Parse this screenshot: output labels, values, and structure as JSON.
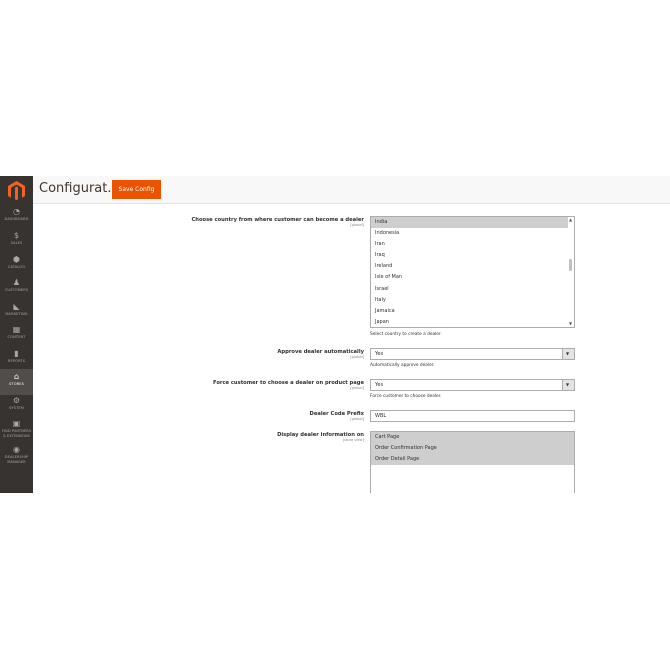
{
  "header": {
    "title": "Configurat...",
    "save_label": "Save Config"
  },
  "sidebar": {
    "items": [
      {
        "label": "DASHBOARD",
        "icon": "dashboard-icon",
        "glyph": "◔"
      },
      {
        "label": "SALES",
        "icon": "dollar-icon",
        "glyph": "$"
      },
      {
        "label": "CATALOG",
        "icon": "cube-icon",
        "glyph": "⬢"
      },
      {
        "label": "CUSTOMERS",
        "icon": "person-icon",
        "glyph": "♟"
      },
      {
        "label": "MARKETING",
        "icon": "megaphone-icon",
        "glyph": "◣"
      },
      {
        "label": "CONTENT",
        "icon": "content-grid-icon",
        "glyph": "▦"
      },
      {
        "label": "REPORTS",
        "icon": "bar-chart-icon",
        "glyph": "▮"
      },
      {
        "label": "STORES",
        "icon": "storefront-icon",
        "glyph": "⌂"
      },
      {
        "label": "SYSTEM",
        "icon": "gear-icon",
        "glyph": "⚙"
      },
      {
        "label": "FIND PARTNERS",
        "label2": "& EXTENSIONS",
        "icon": "box-icon",
        "glyph": "▣"
      },
      {
        "label": "DEALERSHIP",
        "label2": "MANAGER",
        "icon": "circle-logo-icon",
        "glyph": "◉"
      }
    ],
    "active": "STORES"
  },
  "form": {
    "countries": {
      "label": "Choose country from where customer can become a dealer",
      "scope": "[global]",
      "options": [
        "India",
        "Indonesia",
        "Iran",
        "Iraq",
        "Ireland",
        "Isle of Man",
        "Israel",
        "Italy",
        "Jamaica",
        "Japan"
      ],
      "selected": "India",
      "note": "Select country to create a dealer."
    },
    "approve": {
      "label": "Approve dealer automatically",
      "scope": "[global]",
      "value": "Yes",
      "note": "Automatically approve dealer."
    },
    "force": {
      "label": "Force customer to choose a dealer on product page",
      "scope": "[global]",
      "value": "Yes",
      "note": "Force customer to choose dealer."
    },
    "prefix": {
      "label": "Dealer Code Prefix",
      "scope": "[global]",
      "value": "WBL"
    },
    "display": {
      "label": "Display dealer information on",
      "scope": "[store view]",
      "options": [
        "Cart Page",
        "Order Confirmation Page",
        "Order Detail Page"
      ],
      "selected": [
        "Cart Page",
        "Order Confirmation Page",
        "Order Detail Page"
      ]
    }
  },
  "colors": {
    "accent": "#eb5202",
    "sidebar_bg": "#373330",
    "sidebar_active": "#524d49",
    "selected_option": "#cecece"
  }
}
